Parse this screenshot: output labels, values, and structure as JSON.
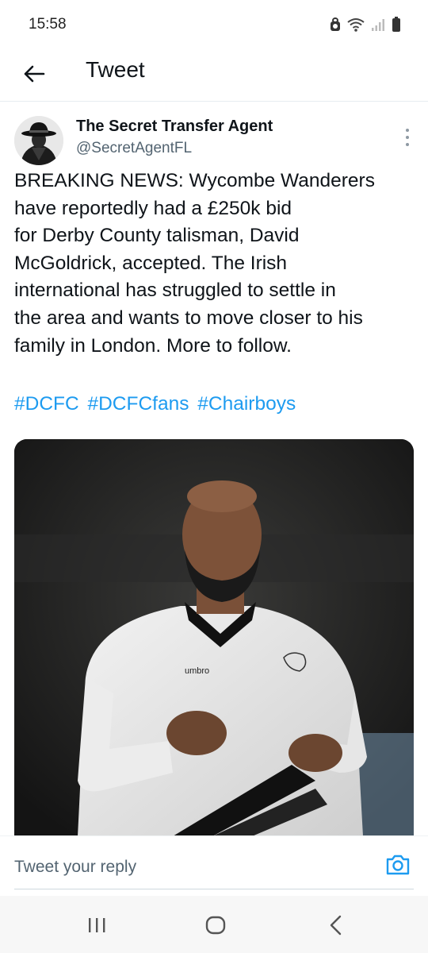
{
  "status_bar": {
    "time": "15:58",
    "icons": [
      "lock-icon",
      "wifi-icon",
      "signal-icon",
      "battery-icon"
    ]
  },
  "header": {
    "back_icon": "arrow-left-icon",
    "title": "Tweet"
  },
  "tweet": {
    "author": {
      "name": "The Secret Transfer Agent",
      "handle": "@SecretAgentFL",
      "avatar": "spy-in-hat-avatar"
    },
    "more_icon": "vertical-ellipsis-icon",
    "text_lines": [
      "BREAKING NEWS: Wycombe Wanderers",
      "have reportedly had a £250k bid",
      "for Derby County talisman, David",
      "McGoldrick, accepted. The Irish",
      "international has struggled to settle in",
      "the area and wants to move closer to his",
      "family in London. More to follow."
    ],
    "hashtags": [
      "#DCFC",
      "#DCFCfans",
      "#Chairboys"
    ],
    "media": {
      "description_icon": "footballer-photo"
    }
  },
  "reply": {
    "placeholder": "Tweet your reply",
    "camera_icon": "camera-icon"
  },
  "nav": {
    "recents_icon": "recent-apps-icon",
    "home_icon": "home-icon",
    "back_icon": "back-chevron-icon"
  },
  "colors": {
    "link": "#1d9bf0",
    "text": "#0f1419",
    "secondary": "#536471"
  }
}
